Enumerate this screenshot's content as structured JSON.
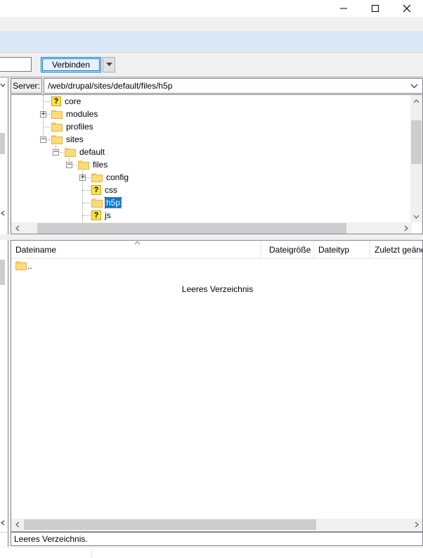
{
  "window": {
    "minimize_glyph": "—",
    "maximize_glyph": "☐",
    "close_glyph": "✕"
  },
  "quickconnect": {
    "connect_label": "Verbinden"
  },
  "server": {
    "label": "Server:",
    "path": "/web/drupal/sites/default/files/h5p"
  },
  "tree": {
    "items": [
      {
        "label": "core",
        "icon": "question-folder-icon"
      },
      {
        "label": "modules",
        "icon": "folder-icon"
      },
      {
        "label": "profiles",
        "icon": "folder-icon"
      },
      {
        "label": "sites",
        "icon": "folder-icon"
      },
      {
        "label": "default",
        "icon": "folder-icon"
      },
      {
        "label": "files",
        "icon": "folder-icon"
      },
      {
        "label": "config",
        "icon": "folder-icon"
      },
      {
        "label": "css",
        "icon": "question-folder-icon"
      },
      {
        "label": "h5p",
        "icon": "folder-icon",
        "selected": true
      },
      {
        "label": "js",
        "icon": "question-folder-icon"
      }
    ]
  },
  "list": {
    "columns": [
      "Dateiname",
      "Dateigröße",
      "Dateityp",
      "Zuletzt geänd"
    ],
    "parent_row": "..",
    "empty_message": "Leeres Verzeichnis"
  },
  "status": {
    "text": "Leeres Verzeichnis."
  },
  "colors": {
    "selection": "#0078d7",
    "folder": "#fddb78",
    "question_folder": "#fde14a",
    "toolbar_strip": "#dbe8f7"
  }
}
